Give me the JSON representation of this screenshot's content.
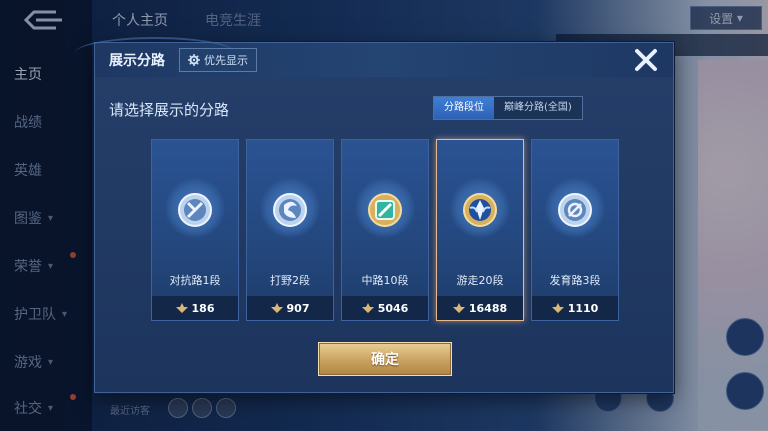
{
  "background": {
    "nav": [
      {
        "label": "主页",
        "active": true,
        "chevron": false
      },
      {
        "label": "战绩",
        "active": false,
        "chevron": false
      },
      {
        "label": "英雄",
        "active": false,
        "chevron": false
      },
      {
        "label": "图鉴",
        "active": false,
        "chevron": true
      },
      {
        "label": "荣誉",
        "active": false,
        "chevron": true
      },
      {
        "label": "护卫队",
        "active": false,
        "chevron": true
      },
      {
        "label": "游戏",
        "active": false,
        "chevron": true
      },
      {
        "label": "社交",
        "active": false,
        "chevron": true
      }
    ],
    "top_tabs": [
      "个人主页",
      "电竞生涯"
    ],
    "settings_label": "设置",
    "recent_label": "最近访客"
  },
  "modal": {
    "title": "展示分路",
    "priority_label": "优先显示",
    "subtitle": "请选择展示的分路",
    "segments": [
      {
        "label": "分路段位",
        "active": true
      },
      {
        "label": "巅峰分路(全国)",
        "active": false
      }
    ],
    "cards": [
      {
        "name": "对抗路1段",
        "points": "186",
        "icon": "solo-lane-badge-icon",
        "selected": false
      },
      {
        "name": "打野2段",
        "points": "907",
        "icon": "jungle-badge-icon",
        "selected": false
      },
      {
        "name": "中路10段",
        "points": "5046",
        "icon": "mid-lane-badge-icon",
        "selected": false
      },
      {
        "name": "游走20段",
        "points": "16488",
        "icon": "roam-badge-icon",
        "selected": true
      },
      {
        "name": "发育路3段",
        "points": "1110",
        "icon": "farm-lane-badge-icon",
        "selected": false
      }
    ],
    "confirm_label": "确定"
  },
  "colors": {
    "accent_blue": "#3f7fd8",
    "gold": "#c9a160",
    "selected_border": "#e7b98c"
  }
}
